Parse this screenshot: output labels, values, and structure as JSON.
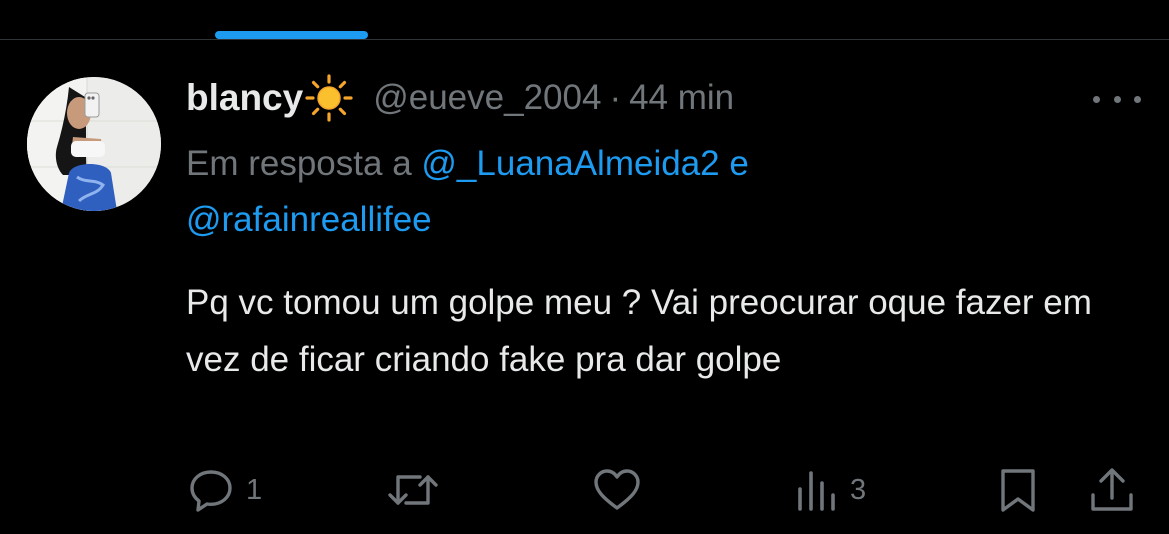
{
  "tweet": {
    "author": {
      "display_name": "blancy",
      "emoji_icon": "sun-icon",
      "handle": "@eueve_2004"
    },
    "separator": "·",
    "time": "44 min",
    "reply_context": {
      "prefix": "Em resposta a",
      "mentions": [
        "@_LuanaAlmeida2",
        "@rafainreallifee"
      ],
      "conjunction": "e"
    },
    "text": "Pq vc tomou um golpe meu ? Vai preocurar oque fazer em vez de ficar criando fake pra dar golpe",
    "actions": {
      "reply": {
        "icon": "reply-icon",
        "count": "1"
      },
      "retweet": {
        "icon": "retweet-icon",
        "count": ""
      },
      "like": {
        "icon": "heart-icon",
        "count": ""
      },
      "views": {
        "icon": "views-icon",
        "count": "3"
      },
      "bookmark": {
        "icon": "bookmark-icon"
      },
      "share": {
        "icon": "share-icon"
      }
    }
  },
  "colors": {
    "background": "#000000",
    "primary_text": "#e7e9ea",
    "secondary_text": "#71767b",
    "accent": "#1d9bf0",
    "divider": "#2f3336"
  }
}
